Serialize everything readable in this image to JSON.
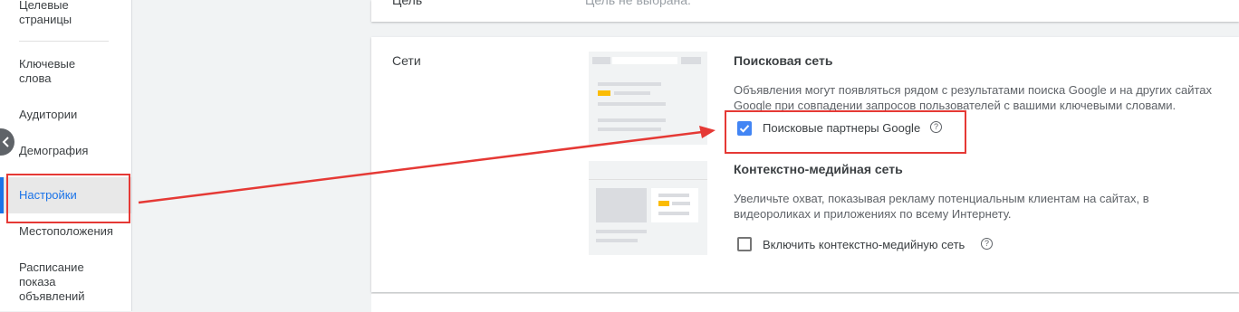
{
  "sidebar": {
    "items": [
      {
        "label": "Целевые\nстраницы"
      },
      {
        "label": "Ключевые\nслова"
      },
      {
        "label": "Аудитории"
      },
      {
        "label": "Демография"
      },
      {
        "label": "Настройки"
      },
      {
        "label": "Местоположения"
      },
      {
        "label": "Расписание\nпоказа\nобъявлений"
      }
    ],
    "active_index": 4
  },
  "goal": {
    "label": "Цель",
    "value": "Цель не выбрана."
  },
  "networks": {
    "label": "Сети",
    "search": {
      "title": "Поисковая сеть",
      "description": "Объявления могут появляться рядом с результатами поиска Google и на других сайтах Google при совпадении запросов пользователей с вашими ключевыми словами.",
      "checkbox_label": "Поисковые партнеры Google",
      "checked": true
    },
    "display": {
      "title": "Контекстно-медийная сеть",
      "description": "Увеличьте охват, показывая рекламу потенциальным клиентам на сайтах, в видеороликах и приложениях по всему Интернету.",
      "checkbox_label": "Включить контекстно-медийную сеть",
      "checked": false
    }
  },
  "colors": {
    "accent": "#1a73e8",
    "checkbox_checked": "#4285f4",
    "annotation_red": "#e53935",
    "illustration_yellow": "#fbbc04"
  }
}
